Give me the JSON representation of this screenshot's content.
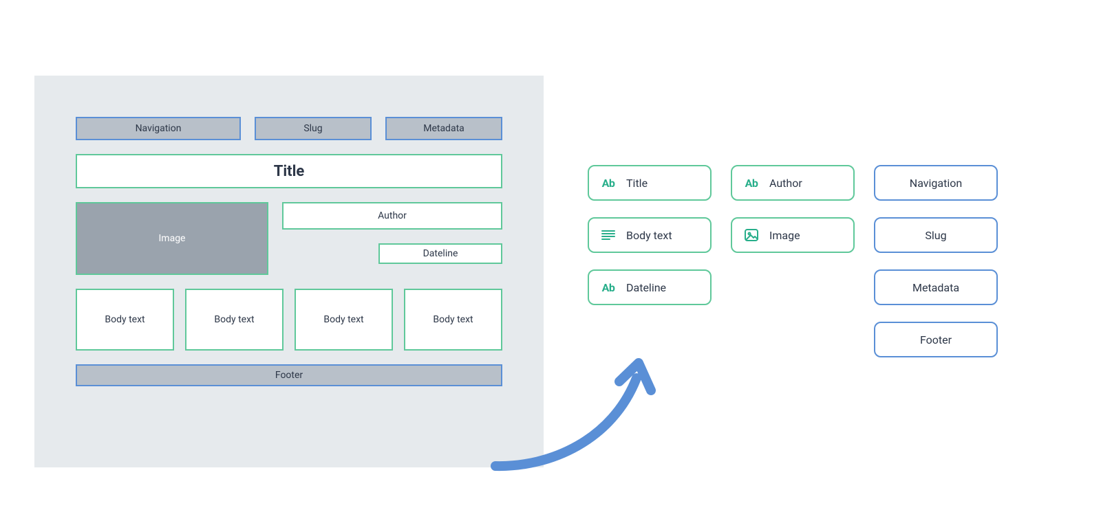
{
  "wireframe": {
    "topRow": {
      "navigation": "Navigation",
      "slug": "Slug",
      "metadata": "Metadata"
    },
    "title": "Title",
    "image": "Image",
    "author": "Author",
    "dateline": "Dateline",
    "bodyText": [
      "Body text",
      "Body text",
      "Body text",
      "Body text"
    ],
    "footer": "Footer"
  },
  "palette": {
    "col1": [
      {
        "icon": "ab",
        "label": "Title"
      },
      {
        "icon": "lines",
        "label": "Body text"
      },
      {
        "icon": "ab",
        "label": "Dateline"
      }
    ],
    "col2": [
      {
        "icon": "ab",
        "label": "Author"
      },
      {
        "icon": "image",
        "label": "Image"
      }
    ],
    "col3": [
      {
        "label": "Navigation"
      },
      {
        "label": "Slug"
      },
      {
        "label": "Metadata"
      },
      {
        "label": "Footer"
      }
    ]
  },
  "colors": {
    "green": "#5fc89a",
    "blue": "#5a8fd6",
    "grayFill": "#b8c0c9",
    "canvasBg": "#e6eaed",
    "iconGreen": "#27ae8a",
    "arrowBlue": "#5a8fd6"
  }
}
